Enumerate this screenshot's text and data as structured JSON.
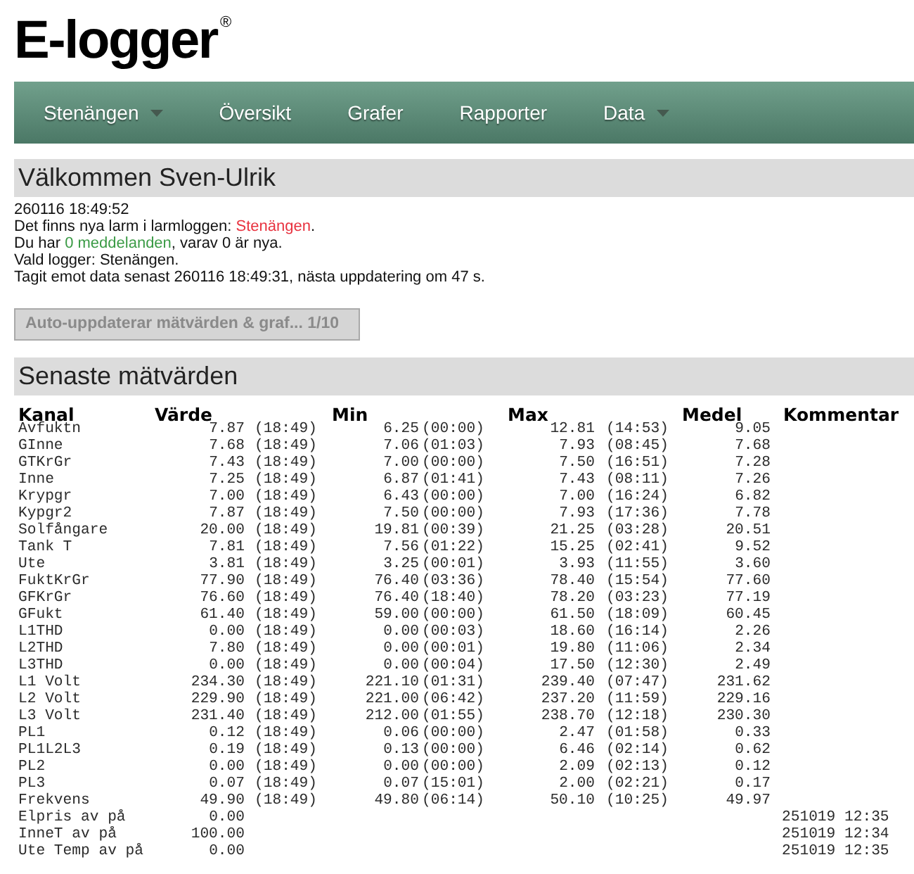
{
  "logo": {
    "text": "E-logger",
    "mark": "®"
  },
  "nav": {
    "items": [
      {
        "label": "Stenängen",
        "dropdown": true
      },
      {
        "label": "Översikt",
        "dropdown": false
      },
      {
        "label": "Grafer",
        "dropdown": false
      },
      {
        "label": "Rapporter",
        "dropdown": false
      },
      {
        "label": "Data",
        "dropdown": true
      }
    ]
  },
  "welcome": {
    "title": "Välkommen Sven-Ulrik",
    "lines": [
      {
        "text": "260116 18:49:52"
      },
      {
        "text": "Det finns nya larm i larmloggen: ",
        "link": {
          "text": "Stenängen",
          "color": "#e8323f"
        },
        "after": "."
      },
      {
        "text": "Du har ",
        "link": {
          "text": "0 meddelanden",
          "color": "#3b9b46"
        },
        "after": ", varav 0 är nya."
      },
      {
        "text": "Vald logger: Stenängen."
      },
      {
        "text": "Tagit emot data senast 260116 18:49:31, nästa uppdatering om 47 s."
      }
    ]
  },
  "auto_update_button": {
    "label": "Auto-uppdaterar mätvärden & graf... 1/10",
    "disabled": true
  },
  "measurements": {
    "title": "Senaste mätvärden",
    "columns": [
      "Kanal",
      "Värde",
      "Min",
      "Max",
      "Medel",
      "Kommentar"
    ],
    "rows": [
      {
        "channel": "Avfuktn",
        "value": "7.87",
        "value_time": "(18:49)",
        "min": "6.25",
        "min_time": "(00:00)",
        "max": "12.81",
        "max_time": "(14:53)",
        "mean": "9.05"
      },
      {
        "channel": "GInne",
        "value": "7.68",
        "value_time": "(18:49)",
        "min": "7.06",
        "min_time": "(01:03)",
        "max": "7.93",
        "max_time": "(08:45)",
        "mean": "7.68"
      },
      {
        "channel": "GTKrGr",
        "value": "7.43",
        "value_time": "(18:49)",
        "min": "7.00",
        "min_time": "(00:00)",
        "max": "7.50",
        "max_time": "(16:51)",
        "mean": "7.28"
      },
      {
        "channel": "Inne",
        "value": "7.25",
        "value_time": "(18:49)",
        "min": "6.87",
        "min_time": "(01:41)",
        "max": "7.43",
        "max_time": "(08:11)",
        "mean": "7.26"
      },
      {
        "channel": "Krypgr",
        "value": "7.00",
        "value_time": "(18:49)",
        "min": "6.43",
        "min_time": "(00:00)",
        "max": "7.00",
        "max_time": "(16:24)",
        "mean": "6.82"
      },
      {
        "channel": "Kypgr2",
        "value": "7.87",
        "value_time": "(18:49)",
        "min": "7.50",
        "min_time": "(00:00)",
        "max": "7.93",
        "max_time": "(17:36)",
        "mean": "7.78"
      },
      {
        "channel": "Solfångare",
        "value": "20.00",
        "value_time": "(18:49)",
        "min": "19.81",
        "min_time": "(00:39)",
        "max": "21.25",
        "max_time": "(03:28)",
        "mean": "20.51"
      },
      {
        "channel": "Tank T",
        "value": "7.81",
        "value_time": "(18:49)",
        "min": "7.56",
        "min_time": "(01:22)",
        "max": "15.25",
        "max_time": "(02:41)",
        "mean": "9.52"
      },
      {
        "channel": "Ute",
        "value": "3.81",
        "value_time": "(18:49)",
        "min": "3.25",
        "min_time": "(00:01)",
        "max": "3.93",
        "max_time": "(11:55)",
        "mean": "3.60"
      },
      {
        "channel": "FuktKrGr",
        "value": "77.90",
        "value_time": "(18:49)",
        "min": "76.40",
        "min_time": "(03:36)",
        "max": "78.40",
        "max_time": "(15:54)",
        "mean": "77.60"
      },
      {
        "channel": "GFKrGr",
        "value": "76.60",
        "value_time": "(18:49)",
        "min": "76.40",
        "min_time": "(18:40)",
        "max": "78.20",
        "max_time": "(03:23)",
        "mean": "77.19"
      },
      {
        "channel": "GFukt",
        "value": "61.40",
        "value_time": "(18:49)",
        "min": "59.00",
        "min_time": "(00:00)",
        "max": "61.50",
        "max_time": "(18:09)",
        "mean": "60.45"
      },
      {
        "channel": "L1THD",
        "value": "0.00",
        "value_time": "(18:49)",
        "min": "0.00",
        "min_time": "(00:03)",
        "max": "18.60",
        "max_time": "(16:14)",
        "mean": "2.26"
      },
      {
        "channel": "L2THD",
        "value": "7.80",
        "value_time": "(18:49)",
        "min": "0.00",
        "min_time": "(00:01)",
        "max": "19.80",
        "max_time": "(11:06)",
        "mean": "2.34"
      },
      {
        "channel": "L3THD",
        "value": "0.00",
        "value_time": "(18:49)",
        "min": "0.00",
        "min_time": "(00:04)",
        "max": "17.50",
        "max_time": "(12:30)",
        "mean": "2.49"
      },
      {
        "channel": "L1 Volt",
        "value": "234.30",
        "value_time": "(18:49)",
        "min": "221.10",
        "min_time": "(01:31)",
        "max": "239.40",
        "max_time": "(07:47)",
        "mean": "231.62"
      },
      {
        "channel": "L2 Volt",
        "value": "229.90",
        "value_time": "(18:49)",
        "min": "221.00",
        "min_time": "(06:42)",
        "max": "237.20",
        "max_time": "(11:59)",
        "mean": "229.16"
      },
      {
        "channel": "L3 Volt",
        "value": "231.40",
        "value_time": "(18:49)",
        "min": "212.00",
        "min_time": "(01:55)",
        "max": "238.70",
        "max_time": "(12:18)",
        "mean": "230.30"
      },
      {
        "channel": "PL1",
        "value": "0.12",
        "value_time": "(18:49)",
        "min": "0.06",
        "min_time": "(00:00)",
        "max": "2.47",
        "max_time": "(01:58)",
        "mean": "0.33"
      },
      {
        "channel": "PL1L2L3",
        "value": "0.19",
        "value_time": "(18:49)",
        "min": "0.13",
        "min_time": "(00:00)",
        "max": "6.46",
        "max_time": "(02:14)",
        "mean": "0.62"
      },
      {
        "channel": "PL2",
        "value": "0.00",
        "value_time": "(18:49)",
        "min": "0.00",
        "min_time": "(00:00)",
        "max": "2.09",
        "max_time": "(02:13)",
        "mean": "0.12"
      },
      {
        "channel": "PL3",
        "value": "0.07",
        "value_time": "(18:49)",
        "min": "0.07",
        "min_time": "(15:01)",
        "max": "2.00",
        "max_time": "(02:21)",
        "mean": "0.17"
      },
      {
        "channel": "Frekvens",
        "value": "49.90",
        "value_time": "(18:49)",
        "min": "49.80",
        "min_time": "(06:14)",
        "max": "50.10",
        "max_time": "(10:25)",
        "mean": "49.97"
      },
      {
        "channel": "Elpris av på",
        "value": "0.00",
        "comment": "251019 12:35"
      },
      {
        "channel": "InneT av på",
        "value": "100.00",
        "comment": "251019 12:34"
      },
      {
        "channel": "Ute Temp av på",
        "value": "0.00",
        "comment": "251019 12:35"
      }
    ]
  }
}
